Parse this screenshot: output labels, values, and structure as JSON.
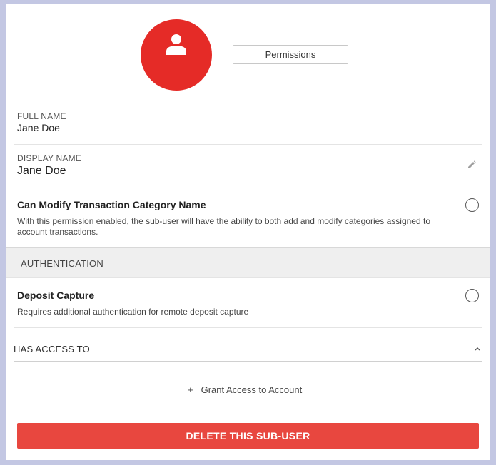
{
  "header": {
    "permissions_label": "Permissions"
  },
  "full_name": {
    "label": "FULL NAME",
    "value": "Jane Doe"
  },
  "display_name": {
    "label": "DISPLAY NAME",
    "value": "Jane Doe"
  },
  "modify_category": {
    "title": "Can Modify Transaction Category Name",
    "description": "With this permission enabled, the sub-user will have the ability to both add and modify categories assigned to account transactions.",
    "enabled": false
  },
  "authentication": {
    "section_title": "AUTHENTICATION",
    "deposit_capture": {
      "title": "Deposit Capture",
      "description": "Requires additional authentication for remote deposit capture",
      "enabled": false
    }
  },
  "access": {
    "header": "HAS ACCESS TO",
    "grant_label": "Grant Access to Account",
    "grant_icon": "+"
  },
  "actions": {
    "delete_label": "DELETE THIS SUB-USER"
  },
  "colors": {
    "avatar": "#e52b27",
    "delete_button": "#e8473f",
    "page_background": "#c3c7e3"
  },
  "icons": {
    "avatar": "user-icon",
    "edit": "pencil-icon",
    "collapse": "chevron-up-icon"
  }
}
